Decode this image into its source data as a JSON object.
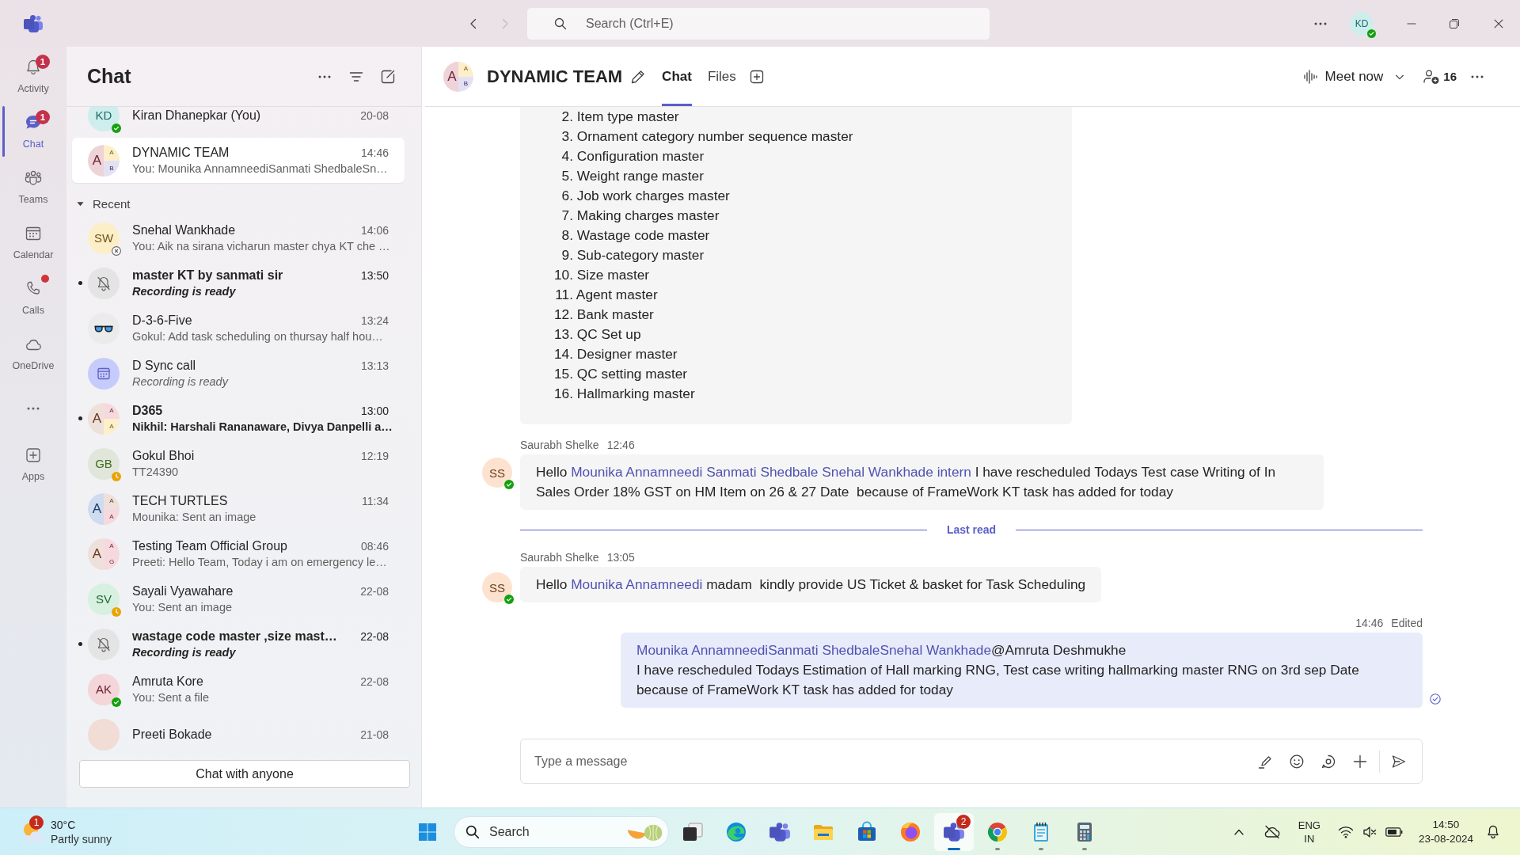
{
  "title_bar": {
    "navigation": {
      "back": {
        "disabled": false
      },
      "forward": {
        "disabled": true
      }
    },
    "search": {
      "placeholder": "Search (Ctrl+E)"
    },
    "account": {
      "kind": "initials",
      "initials": "KD",
      "color": "#cdeeed",
      "presence": {
        "kind": "available"
      }
    }
  },
  "app_rail": {
    "items": [
      {
        "kind": "activity",
        "label": "Activity",
        "selected": false,
        "badge": "1",
        "notification_dot": false
      },
      {
        "kind": "chat",
        "label": "Chat",
        "selected": true,
        "badge": "1",
        "notification_dot": false
      },
      {
        "kind": "teams",
        "label": "Teams",
        "selected": false,
        "notification_dot": false
      },
      {
        "kind": "calendar",
        "label": "Calendar",
        "selected": false,
        "notification_dot": false
      },
      {
        "kind": "calls",
        "label": "Calls",
        "selected": false,
        "notification_dot": true
      },
      {
        "kind": "onedrive",
        "label": "OneDrive",
        "selected": false,
        "notification_dot": false
      },
      {
        "kind": "more",
        "selected": false,
        "notification_dot": false
      },
      {
        "kind": "apps",
        "label": "Apps",
        "selected": false,
        "notification_dot": false
      }
    ]
  },
  "chat_list": {
    "title": "Chat",
    "sections": [
      {
        "items": [
          {
            "name": "Kiran Dhanepkar (You)",
            "time": "20-08",
            "avatar": {
              "kind": "initials",
              "initials": "KD",
              "color": "#cdeeed",
              "presence": {
                "kind": "available"
              }
            },
            "selected": false,
            "unread": false
          },
          {
            "name": "DYNAMIC TEAM",
            "time": "14:46",
            "preview": "You: Mounika AnnamneediSanmati ShedbaleSn…",
            "avatar": {
              "kind": "group",
              "parts": [
                {
                  "letter": "A",
                  "color": "#eed3d8"
                },
                {
                  "letter": "A",
                  "color": "#fcefc9"
                },
                {
                  "letter": "B",
                  "color": "#e4e2f2"
                }
              ]
            },
            "selected": true,
            "unread": false,
            "preview_italic": false
          }
        ]
      },
      {
        "label": "Recent",
        "expanded": true,
        "items": [
          {
            "name": "Snehal Wankhade",
            "time": "14:06",
            "preview": "You: Aik na sirana vicharun master chya KT che …",
            "avatar": {
              "kind": "initials",
              "initials": "SW",
              "color": "#fcefc7",
              "presence": {
                "kind": "offline"
              }
            },
            "selected": false,
            "unread": false,
            "preview_italic": false
          },
          {
            "name": "master KT by sanmati sir",
            "time": "13:50",
            "preview": "Recording is ready",
            "avatar": {
              "kind": "muted"
            },
            "selected": false,
            "unread": true,
            "preview_italic": true
          },
          {
            "name": "D-3-6-Five",
            "time": "13:24",
            "preview": "Gokul: Add task scheduling on thursay half hou…",
            "avatar": {
              "kind": "glasses"
            },
            "selected": false,
            "unread": false,
            "preview_italic": false
          },
          {
            "name": "D Sync call",
            "time": "13:13",
            "preview": "Recording is ready",
            "avatar": {
              "kind": "meeting"
            },
            "selected": false,
            "unread": false,
            "preview_italic": true
          },
          {
            "name": "D365",
            "time": "13:00",
            "preview": "Nikhil: Harshali Rananaware, Divya Danpelli a…",
            "avatar": {
              "kind": "group",
              "parts": [
                {
                  "letter": "A",
                  "color": "#eee0da"
                },
                {
                  "letter": "A",
                  "color": "#f6d9de"
                },
                {
                  "letter": "A",
                  "color": "#fcefc9"
                }
              ]
            },
            "selected": false,
            "unread": true,
            "preview_italic": false
          },
          {
            "name": "Gokul Bhoi",
            "time": "12:19",
            "preview": "TT24390",
            "avatar": {
              "kind": "initials",
              "initials": "GB",
              "color": "#e0e6d9",
              "presence": {
                "kind": "away"
              }
            },
            "selected": false,
            "unread": false,
            "preview_italic": false
          },
          {
            "name": "TECH TURTLES",
            "time": "11:34",
            "preview": "Mounika: Sent an image",
            "avatar": {
              "kind": "group",
              "parts": [
                {
                  "letter": "A",
                  "color": "#cfdcf0"
                },
                {
                  "letter": "A",
                  "color": "#eee0da"
                },
                {
                  "letter": "A",
                  "color": "#f6d9de"
                }
              ]
            },
            "selected": false,
            "unread": false,
            "preview_italic": false
          },
          {
            "name": "Testing Team Official Group",
            "time": "08:46",
            "preview": "Preeti: Hello Team, Today i am on emergency le…",
            "avatar": {
              "kind": "group",
              "parts": [
                {
                  "letter": "A",
                  "color": "#eee0da"
                },
                {
                  "letter": "A",
                  "color": "#f6d9de"
                },
                {
                  "letter": "G",
                  "color": "#f6d9de"
                }
              ]
            },
            "selected": false,
            "unread": false,
            "preview_italic": false
          },
          {
            "name": "Sayali Vyawahare",
            "time": "22-08",
            "preview": "You: Sent an image",
            "avatar": {
              "kind": "initials",
              "initials": "SV",
              "color": "#d7f0df",
              "presence": {
                "kind": "away"
              }
            },
            "selected": false,
            "unread": false,
            "preview_italic": false
          },
          {
            "name": "wastage code master ,size mast…",
            "time": "22-08",
            "preview": "Recording is ready",
            "avatar": {
              "kind": "muted"
            },
            "selected": false,
            "unread": true,
            "preview_italic": true
          },
          {
            "name": "Amruta Kore",
            "time": "22-08",
            "preview": "You: Sent a file",
            "avatar": {
              "kind": "initials",
              "initials": "AK",
              "color": "#f4d5da",
              "presence": {
                "kind": "available"
              }
            },
            "selected": false,
            "unread": false,
            "preview_italic": false
          },
          {
            "name": "Preeti Bokade",
            "time": "21-08",
            "avatar": {
              "kind": "blank",
              "color": "#f1dcd6"
            },
            "selected": false,
            "unread": false
          }
        ]
      }
    ],
    "button": "Chat with anyone"
  },
  "conversation": {
    "header": {
      "avatar": {
        "kind": "group",
        "parts": [
          {
            "letter": "A",
            "color": "#eed3d8"
          },
          {
            "letter": "A",
            "color": "#fcefc9"
          },
          {
            "letter": "B",
            "color": "#e4e2f2"
          }
        ]
      },
      "title": "DYNAMIC TEAM",
      "tabs": [
        {
          "label": "Chat",
          "selected": true
        },
        {
          "label": "Files",
          "selected": false
        }
      ],
      "meet_button": "Meet now",
      "participant_count": "16"
    },
    "messages": [
      {
        "kind": "list",
        "sent": false,
        "items": [
          {
            "number": "2.",
            "text": "Item type master"
          },
          {
            "number": "3.",
            "text": "Ornament category number sequence master"
          },
          {
            "number": "4.",
            "text": "Configuration master"
          },
          {
            "number": "5.",
            "text": "Weight range master"
          },
          {
            "number": "6.",
            "text": "Job work charges master"
          },
          {
            "number": "7.",
            "text": "Making charges master"
          },
          {
            "number": "8.",
            "text": "Wastage code master"
          },
          {
            "number": "9.",
            "text": "Sub-category master"
          },
          {
            "number": "10.",
            "text": "Size master"
          },
          {
            "number": "11.",
            "text": "Agent master"
          },
          {
            "number": "12.",
            "text": "Bank master"
          },
          {
            "number": "13.",
            "text": "QC Set up"
          },
          {
            "number": "14.",
            "text": "Designer master"
          },
          {
            "number": "15.",
            "text": "QC setting master"
          },
          {
            "number": "16.",
            "text": "Hallmarking master"
          }
        ]
      },
      {
        "kind": "text",
        "sent": false,
        "author": "Saurabh Shelke",
        "time": "12:46",
        "avatar": {
          "kind": "initials",
          "initials": "SS",
          "color": "#fde3cf",
          "presence": {
            "kind": "available"
          }
        },
        "paragraphs": [
          [
            {
              "text": "Hello ",
              "mention": false
            },
            {
              "text": "Mounika Annamneedi",
              "mention": true
            },
            {
              "text": " Sanmati Shedbale",
              "mention": true
            },
            {
              "text": " Snehal Wankhade",
              "mention": true
            },
            {
              "text": " intern",
              "mention": true
            },
            {
              "text": " I have rescheduled Todays Test case Writing of In Sales Order 18% GST on HM Item on 26 & 27 Date  because of FrameWork KT task has added for today",
              "mention": false
            }
          ]
        ]
      },
      {
        "kind": "divider",
        "label": "Last read"
      },
      {
        "kind": "text",
        "sent": false,
        "author": "Saurabh Shelke",
        "time": "13:05",
        "avatar": {
          "kind": "initials",
          "initials": "SS",
          "color": "#fde3cf",
          "presence": {
            "kind": "available"
          }
        },
        "paragraphs": [
          [
            {
              "text": "Hello ",
              "mention": false
            },
            {
              "text": "Mounika Annamneedi",
              "mention": true
            },
            {
              "text": " madam  kindly provide US Ticket & basket for Task Scheduling",
              "mention": false
            }
          ]
        ]
      },
      {
        "kind": "text",
        "sent": true,
        "time": "14:46",
        "edited_label": "Edited",
        "read": true,
        "paragraphs": [
          [
            {
              "text": "Mounika Annamneedi",
              "mention": true
            },
            {
              "text": "Sanmati Shedbale",
              "mention": true
            },
            {
              "text": "Snehal Wankhade",
              "mention": true
            },
            {
              "text": "@Amruta Deshmukhe",
              "mention": false
            }
          ],
          [
            {
              "text": "I have rescheduled Todays Estimation of Hall marking RNG, Test case writing hallmarking master RNG on 3rd sep Date because of FrameWork KT task has added for today",
              "mention": false
            }
          ]
        ]
      }
    ],
    "compose": {
      "placeholder": "Type a message"
    }
  },
  "taskbar": {
    "weather": {
      "temperature": "30°C",
      "condition": "Partly sunny",
      "badge": "1"
    },
    "search": {
      "placeholder": "Search"
    },
    "apps": [
      {
        "kind": "task-view",
        "running": false,
        "selected": false
      },
      {
        "kind": "edge",
        "running": false,
        "selected": false
      },
      {
        "kind": "teams-personal",
        "running": false,
        "selected": false
      },
      {
        "kind": "file-explorer",
        "running": false,
        "selected": false
      },
      {
        "kind": "store",
        "running": false,
        "selected": false
      },
      {
        "kind": "firefox",
        "running": false,
        "selected": false
      },
      {
        "kind": "teams",
        "running": true,
        "selected": true,
        "badge": "2"
      },
      {
        "kind": "chrome",
        "running": true,
        "selected": false
      },
      {
        "kind": "notepad",
        "running": true,
        "selected": false
      },
      {
        "kind": "calculator",
        "running": true,
        "selected": false
      }
    ],
    "tray": {
      "language": "ENG",
      "region": "IN",
      "time": "14:50",
      "date": "23-08-2024"
    }
  }
}
